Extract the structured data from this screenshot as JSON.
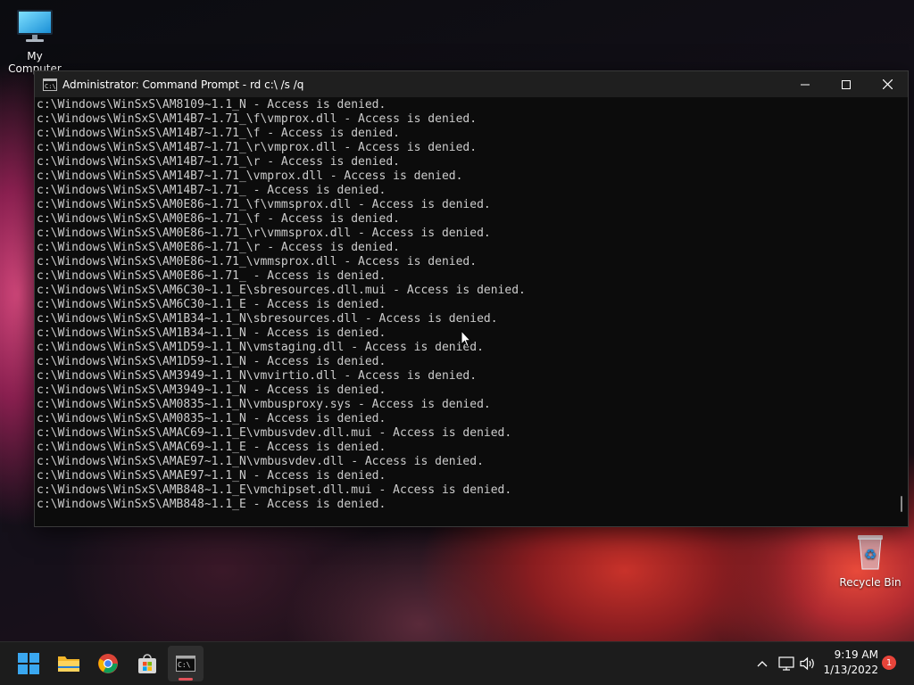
{
  "desktop": {
    "icons": [
      {
        "label": "My Computer",
        "icon": "monitor-icon"
      },
      {
        "label": "Recycle Bin",
        "icon": "recycle-bin-icon"
      }
    ]
  },
  "window": {
    "title": "Administrator: Command Prompt - rd  c:\\ /s /q",
    "console_bg": "#0c0c0c",
    "console_fg": "#cccccc",
    "lines": [
      "c:\\Windows\\WinSxS\\AM8109~1.1_N - Access is denied.",
      "c:\\Windows\\WinSxS\\AM14B7~1.71_\\f\\vmprox.dll - Access is denied.",
      "c:\\Windows\\WinSxS\\AM14B7~1.71_\\f - Access is denied.",
      "c:\\Windows\\WinSxS\\AM14B7~1.71_\\r\\vmprox.dll - Access is denied.",
      "c:\\Windows\\WinSxS\\AM14B7~1.71_\\r - Access is denied.",
      "c:\\Windows\\WinSxS\\AM14B7~1.71_\\vmprox.dll - Access is denied.",
      "c:\\Windows\\WinSxS\\AM14B7~1.71_ - Access is denied.",
      "c:\\Windows\\WinSxS\\AM0E86~1.71_\\f\\vmmsprox.dll - Access is denied.",
      "c:\\Windows\\WinSxS\\AM0E86~1.71_\\f - Access is denied.",
      "c:\\Windows\\WinSxS\\AM0E86~1.71_\\r\\vmmsprox.dll - Access is denied.",
      "c:\\Windows\\WinSxS\\AM0E86~1.71_\\r - Access is denied.",
      "c:\\Windows\\WinSxS\\AM0E86~1.71_\\vmmsprox.dll - Access is denied.",
      "c:\\Windows\\WinSxS\\AM0E86~1.71_ - Access is denied.",
      "c:\\Windows\\WinSxS\\AM6C30~1.1_E\\sbresources.dll.mui - Access is denied.",
      "c:\\Windows\\WinSxS\\AM6C30~1.1_E - Access is denied.",
      "c:\\Windows\\WinSxS\\AM1B34~1.1_N\\sbresources.dll - Access is denied.",
      "c:\\Windows\\WinSxS\\AM1B34~1.1_N - Access is denied.",
      "c:\\Windows\\WinSxS\\AM1D59~1.1_N\\vmstaging.dll - Access is denied.",
      "c:\\Windows\\WinSxS\\AM1D59~1.1_N - Access is denied.",
      "c:\\Windows\\WinSxS\\AM3949~1.1_N\\vmvirtio.dll - Access is denied.",
      "c:\\Windows\\WinSxS\\AM3949~1.1_N - Access is denied.",
      "c:\\Windows\\WinSxS\\AM0835~1.1_N\\vmbusproxy.sys - Access is denied.",
      "c:\\Windows\\WinSxS\\AM0835~1.1_N - Access is denied.",
      "c:\\Windows\\WinSxS\\AMAC69~1.1_E\\vmbusvdev.dll.mui - Access is denied.",
      "c:\\Windows\\WinSxS\\AMAC69~1.1_E - Access is denied.",
      "c:\\Windows\\WinSxS\\AMAE97~1.1_N\\vmbusvdev.dll - Access is denied.",
      "c:\\Windows\\WinSxS\\AMAE97~1.1_N - Access is denied.",
      "c:\\Windows\\WinSxS\\AMB848~1.1_E\\vmchipset.dll.mui - Access is denied.",
      "c:\\Windows\\WinSxS\\AMB848~1.1_E - Access is denied."
    ]
  },
  "taskbar": {
    "apps": [
      {
        "name": "Start",
        "icon": "windows-logo-icon"
      },
      {
        "name": "File Explorer",
        "icon": "folder-icon"
      },
      {
        "name": "Google Chrome",
        "icon": "chrome-icon"
      },
      {
        "name": "Microsoft Store",
        "icon": "store-icon"
      },
      {
        "name": "Command Prompt",
        "icon": "terminal-icon",
        "active": true
      }
    ],
    "tray": {
      "time": "9:19 AM",
      "date": "1/13/2022",
      "notification_count": "1"
    },
    "accent": "#e0525a"
  }
}
